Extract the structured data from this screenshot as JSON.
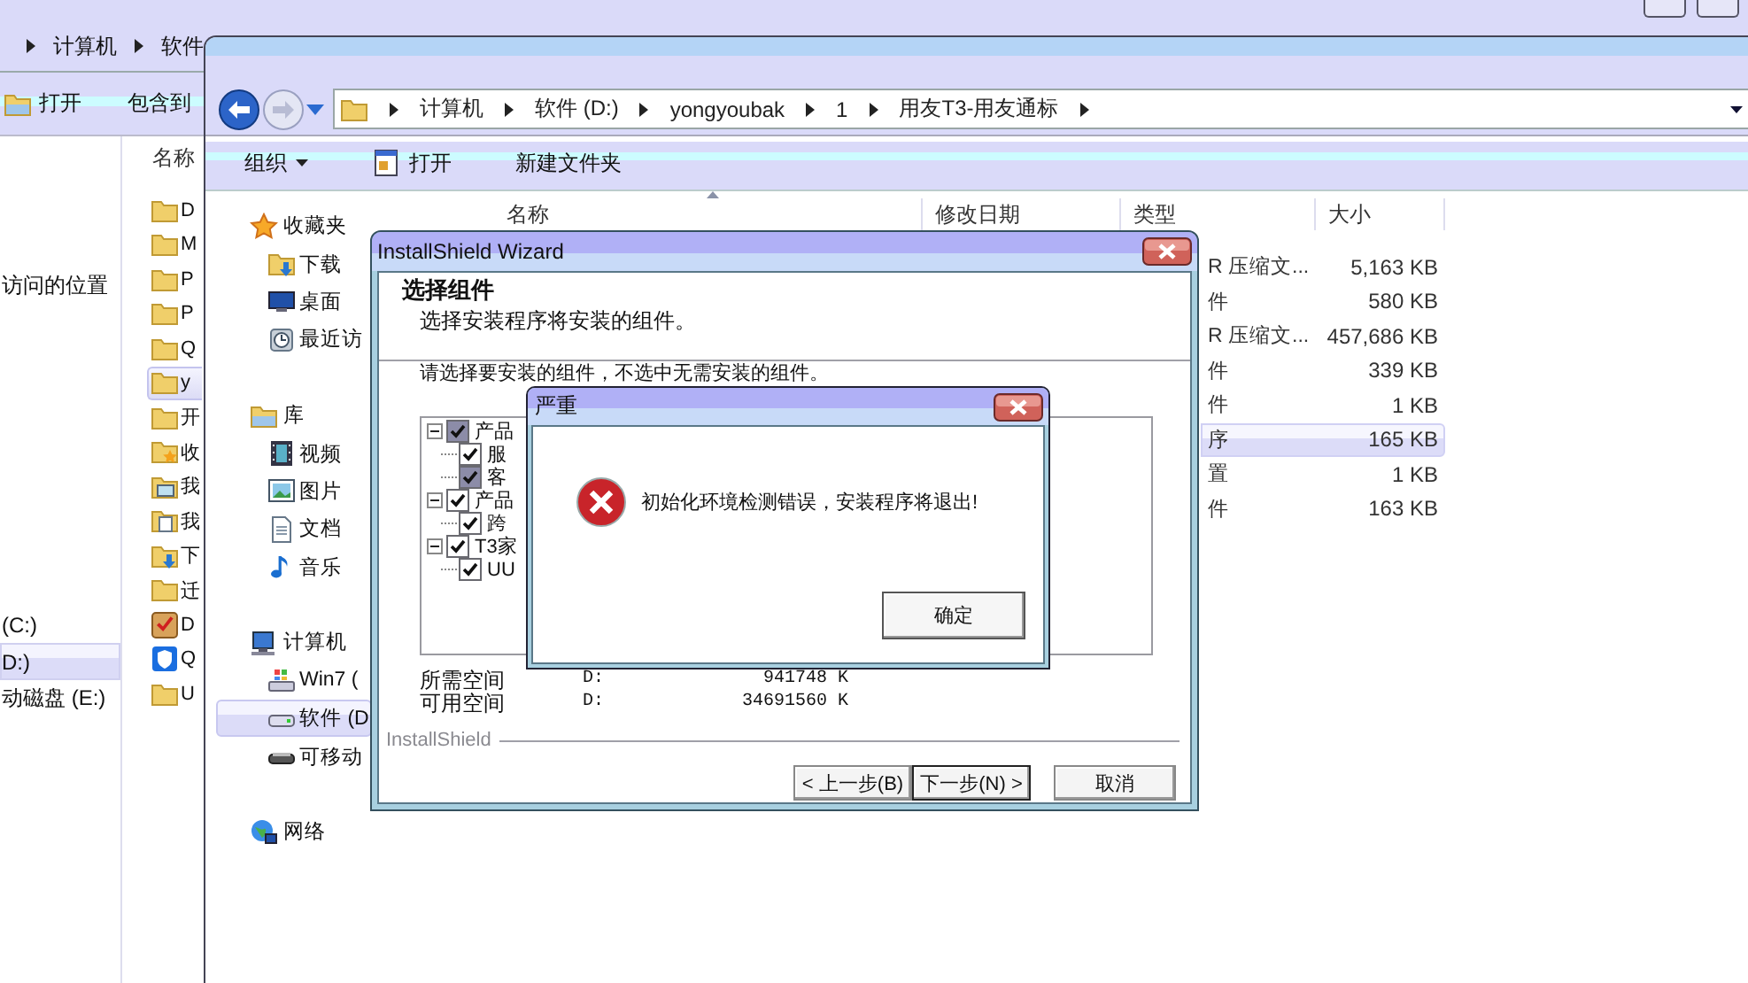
{
  "back_window": {
    "breadcrumb": [
      "计算机",
      "软件"
    ],
    "toolbar": [
      {
        "label": "打开",
        "kind": "folder"
      },
      {
        "label": "包含到",
        "kind": "text"
      }
    ],
    "nav": [
      {
        "label": "访问的位置",
        "selected": false
      },
      {
        "label": "(C:)",
        "selected": false
      },
      {
        "label": "D:)",
        "selected": true
      },
      {
        "label": "动磁盘 (E:)",
        "selected": false
      }
    ],
    "list_header": "名称",
    "files": [
      {
        "name": "D",
        "kind": "folder",
        "selected": false
      },
      {
        "name": "M",
        "kind": "folder",
        "selected": false
      },
      {
        "name": "P",
        "kind": "folder",
        "selected": false
      },
      {
        "name": "P",
        "kind": "folder",
        "selected": false
      },
      {
        "name": "Q",
        "kind": "folder",
        "selected": false
      },
      {
        "name": "y",
        "kind": "folder",
        "selected": true
      },
      {
        "name": "开",
        "kind": "folder",
        "selected": false
      },
      {
        "name": "收",
        "kind": "star-folder",
        "selected": false
      },
      {
        "name": "我",
        "kind": "picture-folder",
        "selected": false
      },
      {
        "name": "我",
        "kind": "document-folder",
        "selected": false
      },
      {
        "name": "下",
        "kind": "download",
        "selected": false
      },
      {
        "name": "迁",
        "kind": "folder",
        "selected": false
      },
      {
        "name": "D",
        "kind": "app",
        "selected": false
      },
      {
        "name": "Q",
        "kind": "shield",
        "selected": false
      },
      {
        "name": "U",
        "kind": "folder",
        "selected": false
      }
    ]
  },
  "explorer": {
    "back_enabled": true,
    "forward_enabled": false,
    "path": [
      "计算机",
      "软件 (D:)",
      "yongyoubak",
      "1",
      "用友T3-用友通标"
    ],
    "toolbar": [
      {
        "label": "组织",
        "kind": "menu"
      },
      {
        "label": "打开",
        "kind": "window"
      },
      {
        "label": "新建文件夹",
        "kind": "text"
      }
    ],
    "nav": [
      {
        "label": "收藏夹",
        "kind": "star",
        "selected": false,
        "children": [
          {
            "label": "下载",
            "kind": "download",
            "selected": false
          },
          {
            "label": "桌面",
            "kind": "desktop",
            "selected": false
          },
          {
            "label": "最近访",
            "kind": "recent",
            "selected": false
          }
        ]
      },
      {
        "label": "库",
        "kind": "library",
        "selected": false,
        "children": [
          {
            "label": "视频",
            "kind": "video",
            "selected": false
          },
          {
            "label": "图片",
            "kind": "picture",
            "selected": false
          },
          {
            "label": "文档",
            "kind": "document",
            "selected": false
          },
          {
            "label": "音乐",
            "kind": "music",
            "selected": false
          }
        ]
      },
      {
        "label": "计算机",
        "kind": "computer",
        "selected": false,
        "children": [
          {
            "label": "Win7 (",
            "kind": "drive-win",
            "selected": false
          },
          {
            "label": "软件 (D",
            "kind": "drive",
            "selected": true
          },
          {
            "label": "可移动",
            "kind": "removable",
            "selected": false
          }
        ]
      },
      {
        "label": "网络",
        "kind": "network",
        "selected": false
      }
    ],
    "columns": [
      "名称",
      "修改日期",
      "类型",
      "大小"
    ],
    "rows": [
      {
        "type": "R 压缩文...",
        "size": "5,163 KB",
        "selected": false
      },
      {
        "type": "件",
        "size": "580 KB",
        "selected": false
      },
      {
        "type": "R 压缩文...",
        "size": "457,686 KB",
        "selected": false
      },
      {
        "type": "件",
        "size": "339 KB",
        "selected": false
      },
      {
        "type": "件",
        "size": "1 KB",
        "selected": false
      },
      {
        "type": "序",
        "size": "165 KB",
        "selected": true
      },
      {
        "type": "置",
        "size": "1 KB",
        "selected": false
      },
      {
        "type": "件",
        "size": "163 KB",
        "selected": false
      }
    ]
  },
  "wizard": {
    "title": "InstallShield Wizard",
    "heading": "选择组件",
    "subheading": "选择安装程序将安装的组件。",
    "instruction": "请选择要安装的组件，不选中无需安装的组件。",
    "components": [
      {
        "label": "产品",
        "checked": true,
        "greyed": true,
        "expanded": true,
        "children": [
          {
            "label": "服",
            "checked": true,
            "greyed": false
          },
          {
            "label": "客",
            "checked": true,
            "greyed": true
          }
        ]
      },
      {
        "label": "产品",
        "checked": true,
        "greyed": false,
        "expanded": true,
        "children": [
          {
            "label": "跨",
            "checked": true,
            "greyed": false
          }
        ]
      },
      {
        "label": "T3家",
        "checked": true,
        "greyed": false,
        "expanded": true,
        "children": [
          {
            "label": "UU",
            "checked": true,
            "greyed": false
          }
        ]
      }
    ],
    "space": [
      {
        "label": "所需空间",
        "drive": "D:",
        "value": "941748 K"
      },
      {
        "label": "可用空间",
        "drive": "D:",
        "value": "34691560 K"
      }
    ],
    "brand": "InstallShield",
    "buttons": [
      {
        "label": "< 上一步(B)",
        "default": false
      },
      {
        "label": "下一步(N) >",
        "default": true
      },
      {
        "label": "取消",
        "default": false
      }
    ]
  },
  "error_dialog": {
    "title": "严重",
    "message": "初始化环境检测错误，安装程序将退出!",
    "button": "确定"
  }
}
